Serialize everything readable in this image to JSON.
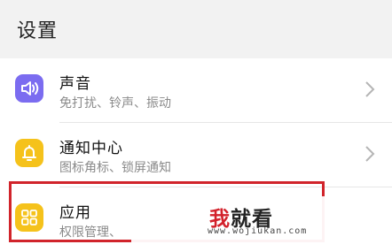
{
  "header": {
    "title": "设置"
  },
  "items": [
    {
      "title": "声音",
      "subtitle": "免打扰、铃声、振动",
      "color": "#7b6cf0",
      "icon": "speaker-icon"
    },
    {
      "title": "通知中心",
      "subtitle": "图标角标、锁屏通知",
      "color": "#f5c21b",
      "icon": "bell-icon"
    },
    {
      "title": "应用",
      "subtitle": "权限管理、",
      "color": "#f5c21b",
      "icon": "apps-grid-icon"
    }
  ],
  "watermark": {
    "logo_first": "我",
    "logo_rest": "就看",
    "url": "www.wojiukan.com"
  },
  "colors": {
    "highlight": "#d1242b",
    "accent_red": "#d3212b"
  }
}
